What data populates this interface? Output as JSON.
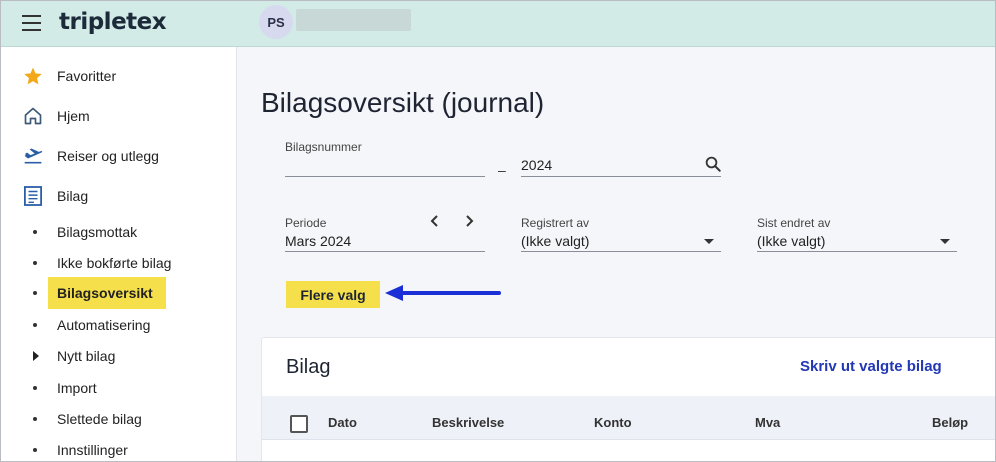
{
  "header": {
    "logo": "tripletex",
    "avatar_initials": "PS"
  },
  "sidebar": {
    "items": [
      {
        "label": "Favoritter",
        "icon": "star-icon"
      },
      {
        "label": "Hjem",
        "icon": "home-icon"
      },
      {
        "label": "Reiser og utlegg",
        "icon": "plane-icon"
      },
      {
        "label": "Bilag",
        "icon": "document-icon"
      }
    ],
    "sub_items": [
      {
        "label": "Bilagsmottak"
      },
      {
        "label": "Ikke bokførte bilag"
      },
      {
        "label": "Bilagsoversikt",
        "active": true
      },
      {
        "label": "Automatisering"
      },
      {
        "label": "Nytt bilag",
        "expandable": true
      },
      {
        "label": "Import"
      },
      {
        "label": "Slettede bilag"
      },
      {
        "label": "Innstillinger"
      }
    ]
  },
  "main": {
    "title": "Bilagsoversikt (journal)",
    "filters": {
      "bilagsnummer_label": "Bilagsnummer",
      "bilagsnummer_from": "",
      "separator": "–",
      "bilagsnummer_to": "2024",
      "periode_label": "Periode",
      "periode_value": "Mars 2024",
      "registrert_label": "Registrert av",
      "registrert_value": "(Ikke valgt)",
      "endret_label": "Sist endret av",
      "endret_value": "(Ikke valgt)"
    },
    "more_button": "Flere valg",
    "card": {
      "title": "Bilag",
      "action": "Skriv ut valgte bilag",
      "columns": [
        "Dato",
        "Beskrivelse",
        "Konto",
        "Mva",
        "Beløp"
      ]
    }
  },
  "colors": {
    "topbar": "#d2ebe7",
    "highlight": "#f5e04b",
    "arrow": "#1a2fd6",
    "link": "#2238b4"
  }
}
